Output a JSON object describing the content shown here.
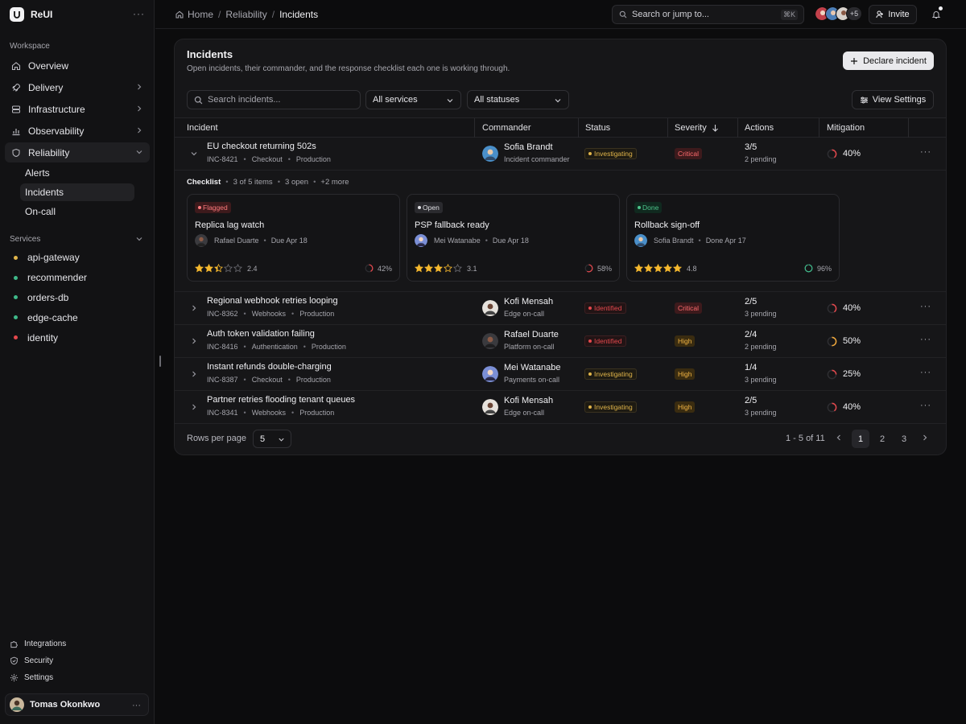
{
  "brand": {
    "name": "ReUI"
  },
  "sidebar": {
    "workspace_label": "Workspace",
    "nav": [
      {
        "label": "Overview",
        "icon": "home-icon"
      },
      {
        "label": "Delivery",
        "icon": "rocket-icon"
      },
      {
        "label": "Infrastructure",
        "icon": "server-icon"
      },
      {
        "label": "Observability",
        "icon": "bar-chart-icon"
      },
      {
        "label": "Reliability",
        "icon": "shield-bug-icon"
      }
    ],
    "reliability_sub": [
      {
        "label": "Alerts"
      },
      {
        "label": "Incidents"
      },
      {
        "label": "On-call"
      }
    ],
    "services_label": "Services",
    "services": [
      {
        "label": "api-gateway",
        "color": "#e1b54a"
      },
      {
        "label": "recommender",
        "color": "#3fb98a"
      },
      {
        "label": "orders-db",
        "color": "#3fb98a"
      },
      {
        "label": "edge-cache",
        "color": "#3fb98a"
      },
      {
        "label": "identity",
        "color": "#e5484d"
      }
    ],
    "footer": [
      {
        "label": "Integrations",
        "icon": "puzzle-icon"
      },
      {
        "label": "Security",
        "icon": "shield-check-icon"
      },
      {
        "label": "Settings",
        "icon": "gear-icon"
      }
    ],
    "user": {
      "name": "Tomas Okonkwo"
    }
  },
  "topbar": {
    "breadcrumb": [
      "Home",
      "Reliability",
      "Incidents"
    ],
    "search_placeholder": "Search or jump to...",
    "search_shortcut": "⌘K",
    "avatars_more": "+5",
    "invite_label": "Invite"
  },
  "card": {
    "title": "Incidents",
    "subtitle": "Open incidents, their commander, and the response checklist each one is working through.",
    "declare_label": "Declare incident",
    "search_placeholder": "Search incidents...",
    "service_filter": "All services",
    "status_filter": "All statuses",
    "view_settings_label": "View Settings"
  },
  "table": {
    "columns": [
      "Incident",
      "Commander",
      "Status",
      "Severity",
      "Actions",
      "Mitigation"
    ],
    "rows": [
      {
        "title": "EU checkout returning 502s",
        "id": "INC-8421",
        "service": "Checkout",
        "env": "Production",
        "commander": "Sofia Brandt",
        "role": "Incident commander",
        "status": "Investigating",
        "severity": "Critical",
        "actions": "3/5",
        "pending": "2 pending",
        "mitigation": "40%",
        "mitigation_value": 0.4,
        "expanded": true
      },
      {
        "title": "Regional webhook retries looping",
        "id": "INC-8362",
        "service": "Webhooks",
        "env": "Production",
        "commander": "Kofi Mensah",
        "role": "Edge on-call",
        "status": "Identified",
        "severity": "Critical",
        "actions": "2/5",
        "pending": "3 pending",
        "mitigation": "40%",
        "mitigation_value": 0.4
      },
      {
        "title": "Auth token validation failing",
        "id": "INC-8416",
        "service": "Authentication",
        "env": "Production",
        "commander": "Rafael Duarte",
        "role": "Platform on-call",
        "status": "Identified",
        "severity": "High",
        "actions": "2/4",
        "pending": "2 pending",
        "mitigation": "50%",
        "mitigation_value": 0.5
      },
      {
        "title": "Instant refunds double-charging",
        "id": "INC-8387",
        "service": "Checkout",
        "env": "Production",
        "commander": "Mei Watanabe",
        "role": "Payments on-call",
        "status": "Investigating",
        "severity": "High",
        "actions": "1/4",
        "pending": "3 pending",
        "mitigation": "25%",
        "mitigation_value": 0.25
      },
      {
        "title": "Partner retries flooding tenant queues",
        "id": "INC-8341",
        "service": "Webhooks",
        "env": "Production",
        "commander": "Kofi Mensah",
        "role": "Edge on-call",
        "status": "Investigating",
        "severity": "High",
        "actions": "2/5",
        "pending": "3 pending",
        "mitigation": "40%",
        "mitigation_value": 0.4
      }
    ]
  },
  "checklist": {
    "label": "Checklist",
    "summary": "3 of 5 items",
    "open": "3 open",
    "more": "+2 more",
    "items": [
      {
        "tag": "Flagged",
        "title": "Replica lag watch",
        "owner": "Rafael Duarte",
        "due": "Due Apr 18",
        "rating": 2.4,
        "rating_label": "2.4",
        "progress": "42%",
        "progress_value": 0.42
      },
      {
        "tag": "Open",
        "title": "PSP fallback ready",
        "owner": "Mei Watanabe",
        "due": "Due Apr 18",
        "rating": 3.1,
        "rating_label": "3.1",
        "progress": "58%",
        "progress_value": 0.58
      },
      {
        "tag": "Done",
        "title": "Rollback sign-off",
        "owner": "Sofia Brandt",
        "due": "Done Apr 17",
        "rating": 4.8,
        "rating_label": "4.8",
        "progress": "96%",
        "progress_value": 0.96
      }
    ]
  },
  "pagination": {
    "rows_per_page_label": "Rows per page",
    "rows_per_page": "5",
    "range": "1 - 5 of 11",
    "pages": [
      "1",
      "2",
      "3"
    ]
  }
}
